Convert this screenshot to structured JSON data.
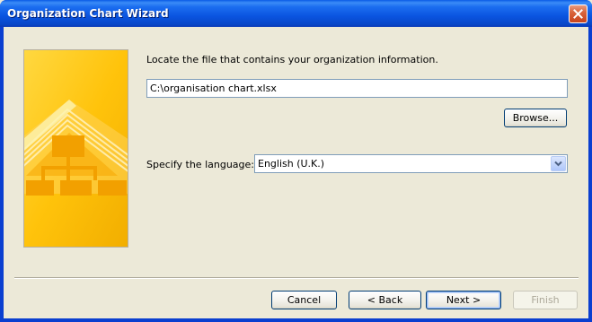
{
  "window": {
    "title": "Organization Chart Wizard",
    "close_icon": "close-icon"
  },
  "main": {
    "prompt": "Locate the file that contains your organization information.",
    "file_path": "C:\\organisation chart.xlsx",
    "browse_label": "Browse...",
    "language_label": "Specify the language:",
    "language_value": "English (U.K.)",
    "language_arrow_icon": "chevron-down-icon"
  },
  "footer": {
    "cancel_label": "Cancel",
    "back_label": "< Back",
    "next_label": "Next >",
    "finish_label": "Finish"
  },
  "colors": {
    "titlebar": "#0a54e0",
    "banner": "#ffc30b",
    "dialog_bg": "#ece9d8"
  }
}
